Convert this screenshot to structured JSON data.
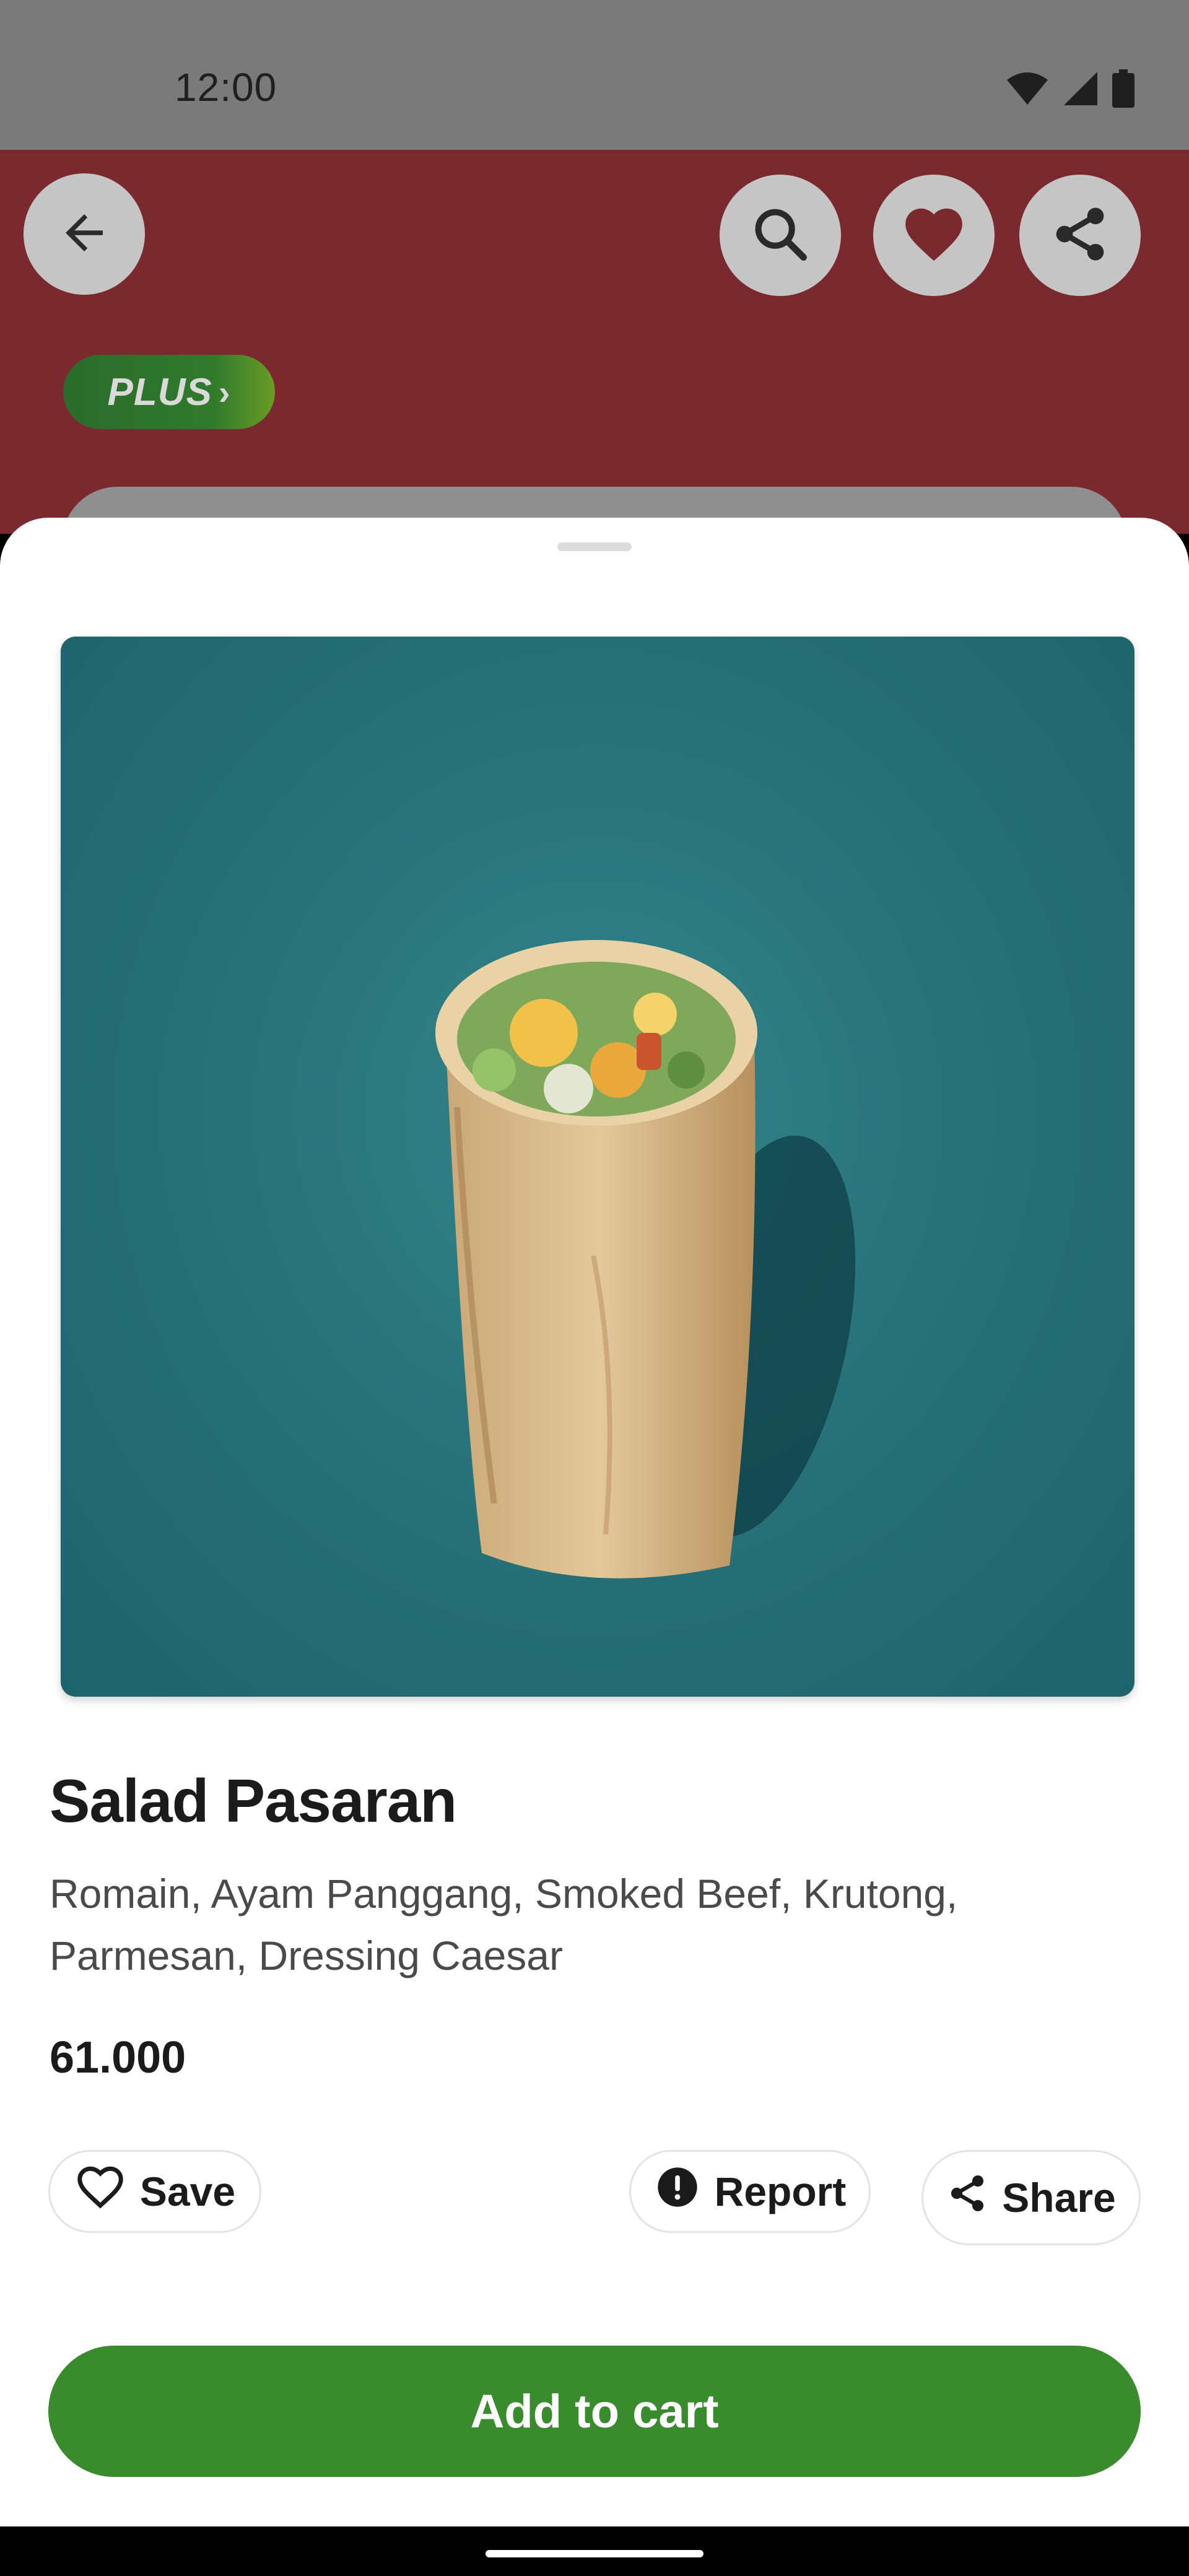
{
  "status_bar": {
    "time": "12:00"
  },
  "header": {
    "plus_label": "PLUS",
    "plus_chevron": "›"
  },
  "product": {
    "title": "Salad Pasaran",
    "description": "Romain, Ayam Panggang, Smoked Beef, Krutong, Parmesan, Dressing Caesar",
    "price": "61.000"
  },
  "actions": {
    "save": "Save",
    "report": "Report",
    "share": "Share"
  },
  "cart": {
    "label": "Add to cart"
  },
  "icons": [
    "back-arrow-icon",
    "search-icon",
    "heart-filled-icon",
    "share-icon",
    "wifi-icon",
    "signal-icon",
    "battery-icon",
    "heart-outline-icon",
    "alert-circle-icon"
  ],
  "colors": {
    "header_dim": "#7a2a2f",
    "accent_green": "#3a8a2e",
    "photo_bg": "#266f77"
  }
}
